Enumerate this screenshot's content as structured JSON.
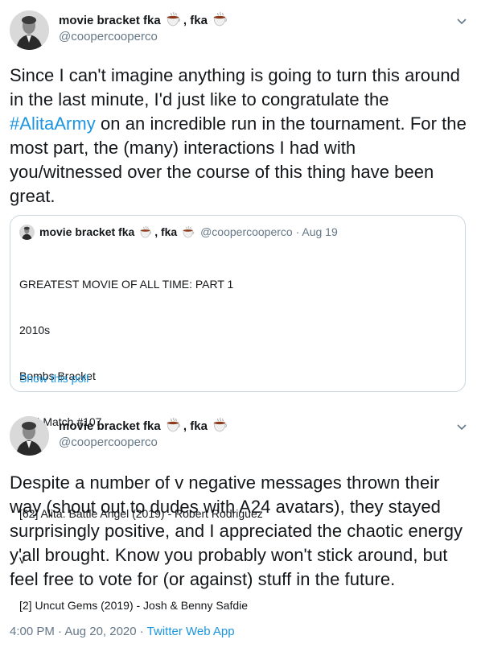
{
  "tweet1": {
    "display_name": "movie bracket fka",
    "display_name_sep": ", fka",
    "emoji": "hot-beverage-icon",
    "handle": "@coopercooperco",
    "text_before": "Since I can't imagine anything is going to turn this around in the last minute, I'd just like to congratulate the ",
    "hashtag": "#AlitaArmy",
    "text_after": " on an incredible run in the tournament. For the most part, the (many) interactions I had with you/witnessed over the course of this thing have been great."
  },
  "quote": {
    "display_name": "movie bracket fka",
    "display_name_sep": ", fka",
    "handle_date": "@coopercooperco · Aug 19",
    "lines": [
      "GREATEST MOVIE OF ALL TIME: PART 1",
      "2010s",
      "Bombs Bracket",
      "R6 | Match #107",
      "",
      "[62] Alita: Battle Angel (2019) - Robert Rodriguez",
      "v",
      "[2] Uncut Gems (2019) - Josh & Benny Safdie"
    ],
    "show_poll": "Show this poll"
  },
  "tweet2": {
    "display_name": "movie bracket fka",
    "display_name_sep": ", fka",
    "handle": "@coopercooperco",
    "text": "Despite a number of v negative messages thrown their way (shout out to dudes with A24 avatars), they stayed surprisingly positive, and I appreciated the chaotic energy y'all brought. Know you probably won't stick around, but feel free to vote for (or against) stuff in the future.",
    "timestamp": "4:00 PM · Aug 20, 2020 · ",
    "app": "Twitter Web App"
  },
  "colors": {
    "link": "#1b95e0",
    "muted": "#657786",
    "border": "#ccd6dd"
  }
}
